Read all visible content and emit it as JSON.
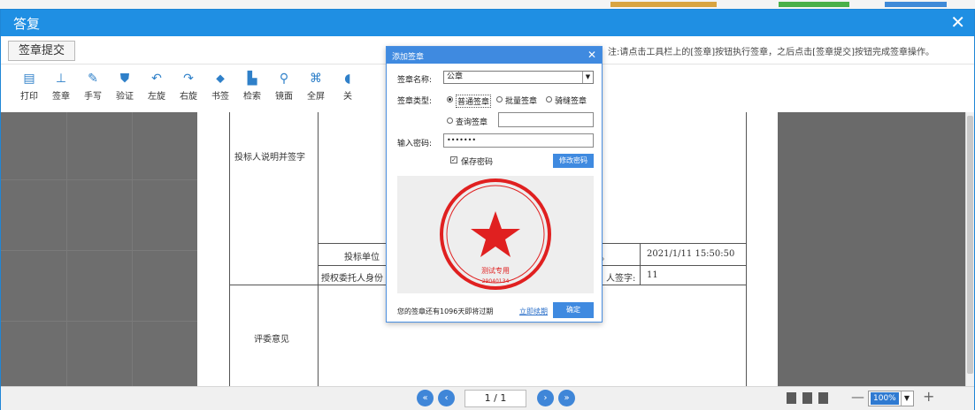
{
  "top_strip": {
    "segments": [
      "#d9a441",
      "#4ab04a",
      "#3f8ad8"
    ]
  },
  "window": {
    "title": "答复",
    "close_glyph": "✕"
  },
  "submit_bar": {
    "submit_label": "签章提交",
    "note": "注:请点击工具栏上的[签章]按钮执行签章，之后点击[签章提交]按钮完成签章操作。"
  },
  "toolbar": {
    "items": [
      {
        "label": "打印",
        "icon": "printer-icon",
        "glyph": "▤"
      },
      {
        "label": "签章",
        "icon": "stamp-icon",
        "glyph": "⊥"
      },
      {
        "label": "手写",
        "icon": "pen-icon",
        "glyph": "✎"
      },
      {
        "label": "验证",
        "icon": "shield-icon",
        "glyph": "⛊"
      },
      {
        "label": "左旋",
        "icon": "rotate-left-icon",
        "glyph": "↶"
      },
      {
        "label": "右旋",
        "icon": "rotate-right-icon",
        "glyph": "↷"
      },
      {
        "label": "书签",
        "icon": "bookmark-icon",
        "glyph": "⬥"
      },
      {
        "label": "检索",
        "icon": "document-search-icon",
        "glyph": "▙"
      },
      {
        "label": "镜面",
        "icon": "magnifier-icon",
        "glyph": "⚲"
      },
      {
        "label": "全屏",
        "icon": "fullscreen-icon",
        "glyph": "⌘"
      },
      {
        "label": "关",
        "icon": "close-doc-icon",
        "glyph": "◖"
      }
    ]
  },
  "document": {
    "row_label_signer_note": "投标人说明并签字",
    "row_label_bid_unit": "投标单位",
    "row_label_authorized": "授权委托人身份",
    "date_suffix": "。",
    "timestamp": "2021/1/11 15:50:50",
    "signature_label": "人签字:",
    "signature_value": "11",
    "row_label_expert": "评委意见"
  },
  "pager": {
    "page": "1 / 1",
    "zoom": "100%"
  },
  "dialog": {
    "title": "添加签章",
    "close_glyph": "✕",
    "seal_name_label": "签章名称:",
    "seal_name_value": "公章",
    "seal_type_label": "签章类型:",
    "type_options": [
      "普通签章",
      "批量签章",
      "骑缝签章",
      "查询签章"
    ],
    "selected_type": "普通签章",
    "password_label": "输入密码:",
    "password_value": "•••••••",
    "save_password_label": "保存密码",
    "save_password_checked": true,
    "modify_password_btn": "修改密码",
    "seal_center_text": "测试专用",
    "seal_serial": "29040134",
    "footer_text": "您的签章还有1096天即将过期",
    "footer_link": "立即续期",
    "ok_button": "确定",
    "seal_color": "#e02020"
  }
}
